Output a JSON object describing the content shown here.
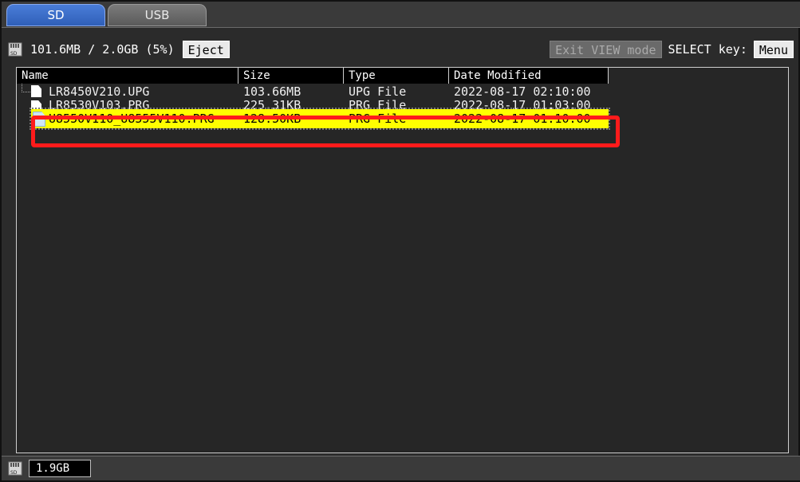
{
  "tabs": [
    {
      "label": "SD",
      "active": true
    },
    {
      "label": "USB",
      "active": false
    }
  ],
  "info": {
    "storage_text": "101.6MB / 2.0GB (5%)",
    "eject_label": "Eject",
    "exit_view_label": "Exit VIEW mode",
    "select_key_label": "SELECT key:",
    "menu_label": "Menu"
  },
  "list": {
    "headers": {
      "name": "Name",
      "size": "Size",
      "type": "Type",
      "date": "Date Modified"
    },
    "rows": [
      {
        "name": "LR8450V210.UPG",
        "size": "103.66MB",
        "type": "UPG File",
        "date": "2022-08-17 02:10:00"
      },
      {
        "name": "LR8530V103.PRG",
        "size": "225.31KB",
        "type": "PRG File",
        "date": "2022-08-17 01:03:00"
      },
      {
        "name": "U8550V110_U8555V110.PRG",
        "size": "128.50KB",
        "type": "PRG File",
        "date": "2022-08-17 01:10:00"
      }
    ]
  },
  "status": {
    "free_space": "1.9GB"
  },
  "colors": {
    "selection_bg": "#ffff00",
    "highlight_border": "#ff1b1b",
    "active_tab": "#3a6fd0"
  },
  "icons": {
    "sd": "sd-card-icon",
    "file": "file-icon"
  }
}
